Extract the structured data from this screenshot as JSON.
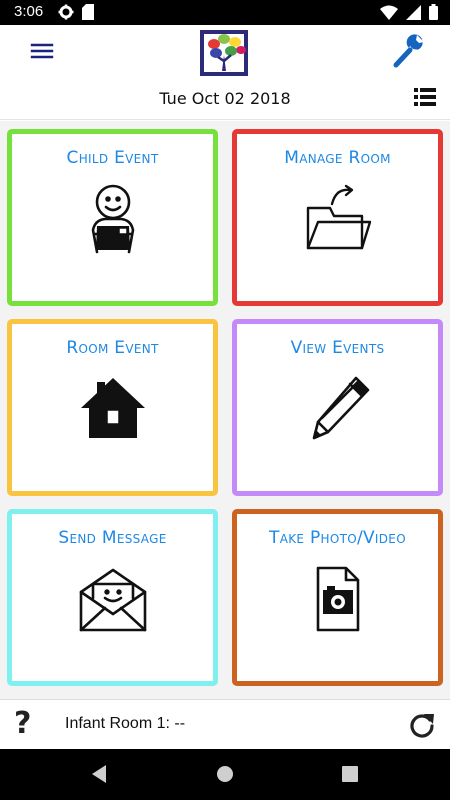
{
  "status_bar": {
    "time": "3:06",
    "icons": [
      "settings-icon",
      "sd-card-icon",
      "wifi-icon",
      "signal-icon",
      "battery-icon"
    ]
  },
  "header": {
    "date": "Tue Oct 02 2018",
    "menu_icon": "hamburger-menu-icon",
    "logo": "tree-logo",
    "settings_icon": "wrench-icon",
    "list_icon": "list-view-icon"
  },
  "tiles": [
    {
      "label": "Child Event",
      "icon": "child-face-icon",
      "border_color": "#76e03c"
    },
    {
      "label": "Manage Room",
      "icon": "folder-icon",
      "border_color": "#e53935"
    },
    {
      "label": "Room Event",
      "icon": "house-icon",
      "border_color": "#f9c440"
    },
    {
      "label": "View Events",
      "icon": "pencil-icon",
      "border_color": "#c58af9"
    },
    {
      "label": "Send Message",
      "icon": "envelope-icon",
      "border_color": "#7ff0ef"
    },
    {
      "label": "Take Photo/Video",
      "icon": "camera-file-icon",
      "border_color": "#cc6321"
    }
  ],
  "footer": {
    "help_label": "?",
    "room_status": "Infant Room 1: --",
    "refresh_icon": "refresh-icon"
  },
  "colors": {
    "label": "#1e88e5",
    "header_icon": "#1a237e",
    "wrench": "#1565c0"
  }
}
